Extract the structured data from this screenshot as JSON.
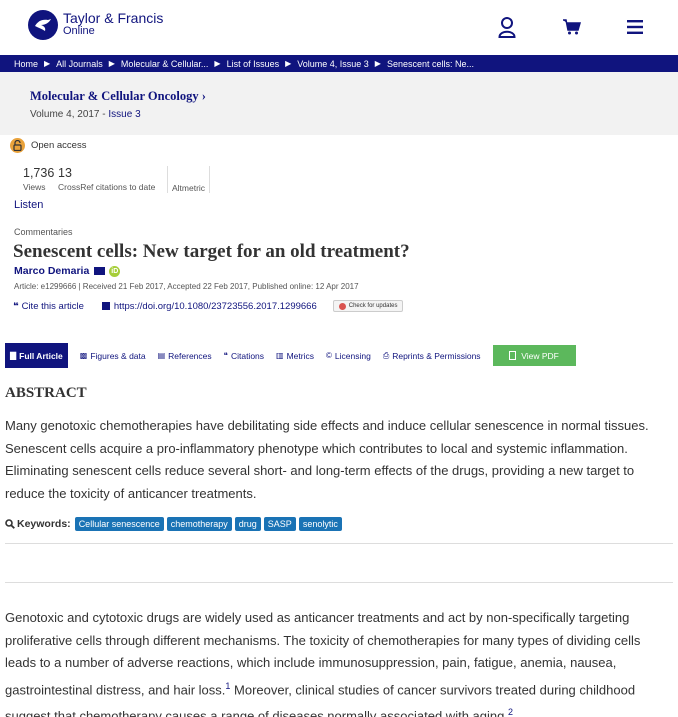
{
  "header": {
    "brand_line1": "Taylor & Francis",
    "brand_line2": "Online",
    "colors": {
      "brand": "#10147e"
    },
    "icons": [
      "user-icon",
      "cart-icon",
      "menu-icon"
    ]
  },
  "breadcrumb": [
    "Home",
    "All Journals",
    "Molecular & Cellular...",
    "List of Issues",
    "Volume 4, Issue 3",
    "Senescent cells: Ne..."
  ],
  "journal": {
    "name": "Molecular & Cellular Oncology",
    "chevron": "›",
    "volume": "Volume 4, 2017",
    "separator": "-",
    "issue": "Issue 3"
  },
  "access": {
    "label": "Open access"
  },
  "metrics": {
    "views_num": "1,736",
    "views_label": "Views",
    "crossref_num": "13",
    "crossref_label": "CrossRef citations to date",
    "altmetric_label": "Altmetric"
  },
  "listen": "Listen",
  "article": {
    "category": "Commentaries",
    "title": "Senescent cells: New target for an old treatment?",
    "author": "Marco Demaria",
    "meta": "Article: e1299666 | Received 21 Feb 2017, Accepted 22 Feb 2017, Published online: 12 Apr 2017",
    "cite_label": "Cite this article",
    "doi": "https://doi.org/10.1080/23723556.2017.1299666",
    "check_updates": "Check for updates"
  },
  "tabs": [
    {
      "label": "Full Article",
      "icon": "doc-icon",
      "glyph": "▇"
    },
    {
      "label": "Figures & data",
      "icon": "image-icon",
      "glyph": "▩"
    },
    {
      "label": "References",
      "icon": "book-icon",
      "glyph": "▤"
    },
    {
      "label": "Citations",
      "icon": "quote-icon",
      "glyph": "❝"
    },
    {
      "label": "Metrics",
      "icon": "bar-chart-icon",
      "glyph": "▥"
    },
    {
      "label": "Licensing",
      "icon": "copyright-icon",
      "glyph": "©"
    },
    {
      "label": "Reprints & Permissions",
      "icon": "print-icon",
      "glyph": "⎙"
    }
  ],
  "pdf_button": "View PDF",
  "abstract": {
    "title": "ABSTRACT",
    "text": "Many genotoxic chemotherapies have debilitating side effects and induce cellular senescence in normal tissues. Senescent cells acquire a pro-inflammatory phenotype which contributes to local and systemic inflammation. Eliminating senescent cells reduce several short- and long-term effects of the drugs, providing a new target to reduce the toxicity of anticancer treatments."
  },
  "keywords": {
    "label": "Keywords:",
    "items": [
      "Cellular senescence",
      "chemotherapy",
      "drug",
      "SASP",
      "senolytic"
    ]
  },
  "body": {
    "part1": "Genotoxic and cytotoxic drugs are widely used as anticancer treatments and act by non-specifically targeting proliferative cells through different mechanisms. The toxicity of chemotherapies for many types of dividing cells leads to a number of adverse reactions, which include immunosuppression, pain, fatigue, anemia, nausea, gastrointestinal distress, and hair loss.",
    "ref1": "1",
    "part2": " Moreover, clinical studies of cancer survivors treated during childhood suggest that chemotherapy causes a range of diseases normally associated with aging.",
    "ref2": "2"
  }
}
